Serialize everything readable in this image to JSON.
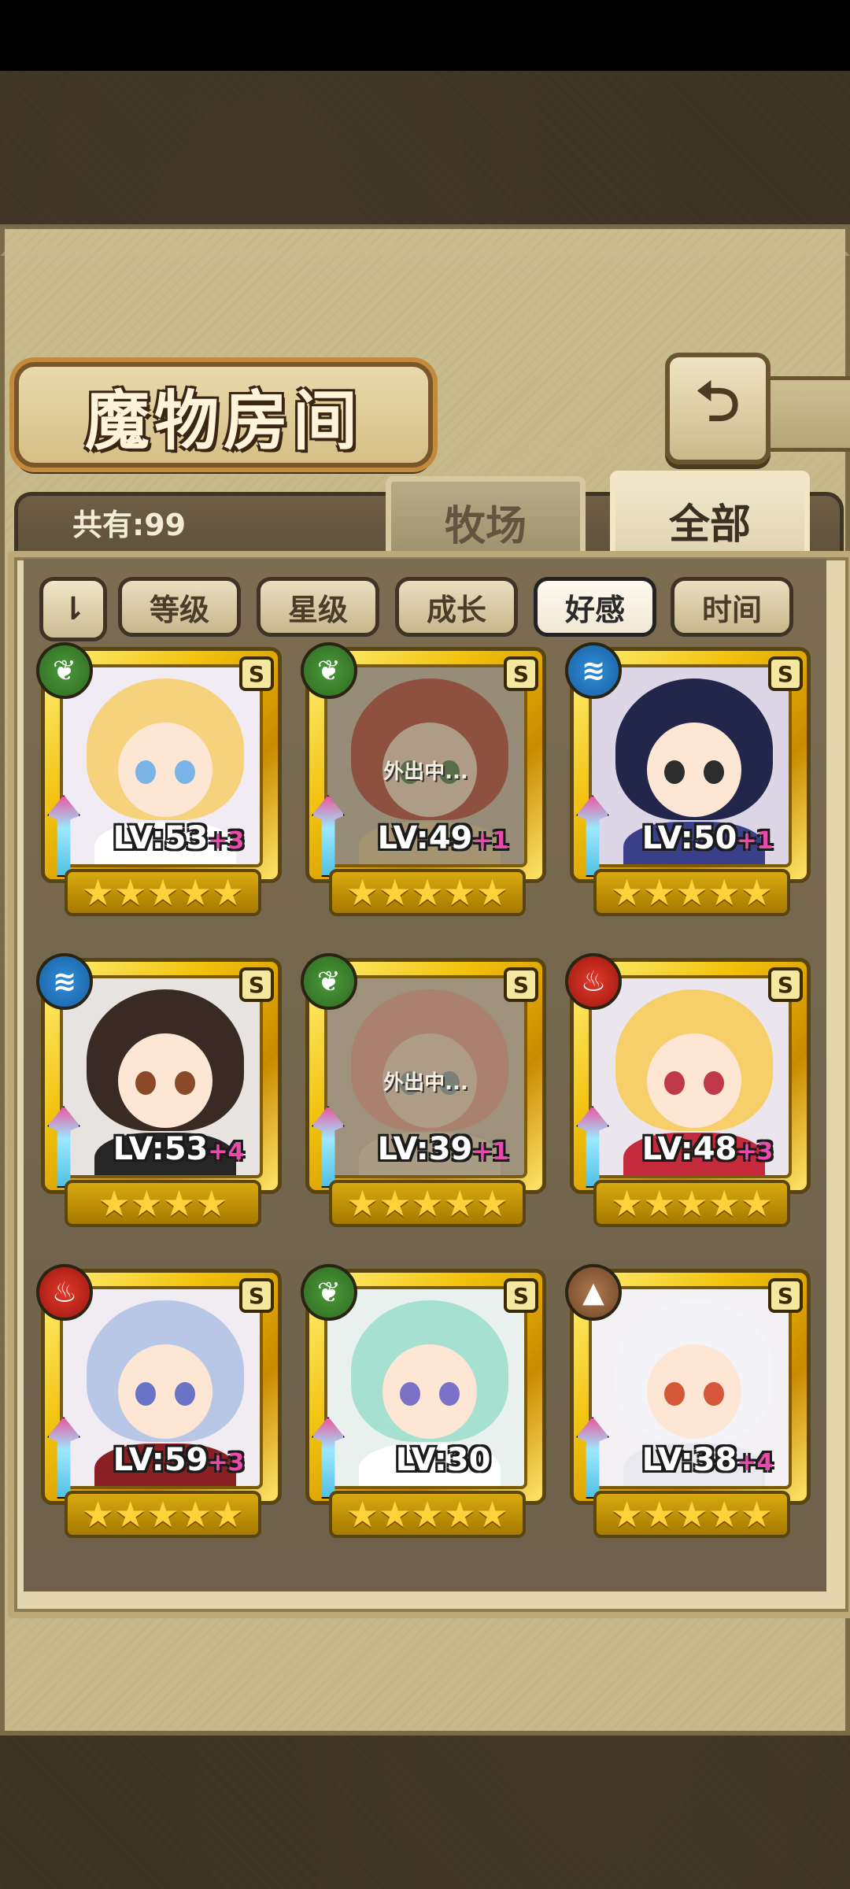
{
  "title": "魔物房间",
  "back_icon": "⮌",
  "count_label": "共有:99",
  "tabs": [
    {
      "label": "牧场",
      "active": false
    },
    {
      "label": "全部",
      "active": true
    }
  ],
  "sort_toggle_icon": "⇂",
  "filters": [
    {
      "label": "等级",
      "active": false
    },
    {
      "label": "星级",
      "active": false
    },
    {
      "label": "成长",
      "active": false
    },
    {
      "label": "好感",
      "active": true
    },
    {
      "label": "时间",
      "active": false
    }
  ],
  "monsters": [
    {
      "element": "leaf",
      "rank": "S",
      "level": "LV:53",
      "plus": "+3",
      "stars": "★★★★★",
      "away": "",
      "hair": "#f7d27c",
      "eye": "#7ab4e6",
      "outfit": "#ffffff",
      "bg": "#f1ecf4"
    },
    {
      "element": "leaf",
      "rank": "S",
      "level": "LV:49",
      "plus": "+1",
      "stars": "★★★★★",
      "away": "外出中...",
      "hair": "#b64038",
      "eye": "#3f7d4a",
      "outfit": "#e9d6a6",
      "bg": "#c9c4b3"
    },
    {
      "element": "water",
      "rank": "S",
      "level": "LV:50",
      "plus": "+1",
      "stars": "★★★★★",
      "away": "",
      "hair": "#22264a",
      "eye": "#2d2d2d",
      "outfit": "#3a3f8a",
      "bg": "#dcd6e6"
    },
    {
      "element": "water",
      "rank": "S",
      "level": "LV:53",
      "plus": "+4",
      "stars": "★★★★",
      "away": "",
      "hair": "#3a2a24",
      "eye": "#8a4a2a",
      "outfit": "#262626",
      "bg": "#e7e3e0"
    },
    {
      "element": "leaf",
      "rank": "S",
      "level": "LV:39",
      "plus": "+1",
      "stars": "★★★★★",
      "away": "外出中...",
      "hair": "#f3a9a2",
      "eye": "#8aa6b6",
      "outfit": "#f0e6d2",
      "bg": "#d9d0c0"
    },
    {
      "element": "fire",
      "rank": "S",
      "level": "LV:48",
      "plus": "+3",
      "stars": "★★★★★",
      "away": "",
      "hair": "#f6cf6a",
      "eye": "#c0394a",
      "outfit": "#c52a3c",
      "bg": "#ebe6ee"
    },
    {
      "element": "fire",
      "rank": "S",
      "level": "LV:59",
      "plus": "+3",
      "stars": "★★★★★",
      "away": "",
      "hair": "#b9c7e6",
      "eye": "#6a74c7",
      "outfit": "#8a1f24",
      "bg": "#f0ecf2"
    },
    {
      "element": "leaf",
      "rank": "S",
      "level": "LV:30",
      "plus": "",
      "stars": "★★★★★",
      "away": "",
      "hair": "#a6e0d0",
      "eye": "#7b72c8",
      "outfit": "#ffffff",
      "bg": "#e8f1ee"
    },
    {
      "element": "earth",
      "rank": "S",
      "level": "LV:38",
      "plus": "+4",
      "stars": "★★★★★",
      "away": "",
      "hair": "#f4f4f8",
      "eye": "#d4573a",
      "outfit": "#e8e8ee",
      "bg": "#f3f1f4"
    }
  ]
}
